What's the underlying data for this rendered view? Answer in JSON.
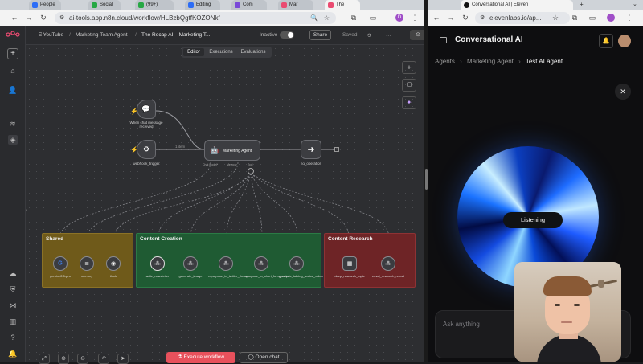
{
  "left_browser": {
    "tabs": [
      {
        "label": "People",
        "color": "#2d6df6"
      },
      {
        "label": "Social",
        "color": "#27a844"
      },
      {
        "label": "(99+)",
        "color": "#27a844"
      },
      {
        "label": "Editing",
        "color": "#2d6df6"
      },
      {
        "label": "Com",
        "color": "#7a4ad8"
      },
      {
        "label": "Mar",
        "color": "#ea4b71"
      },
      {
        "label": "The",
        "color": "#ea4b71"
      }
    ],
    "url": "ai-tools.app.n8n.cloud/workflow/HLBzbQgtfKOZONkf",
    "profile_initial": "D"
  },
  "n8n": {
    "breadcrumb": {
      "project": "YouTube",
      "folder": "Marketing Team Agent",
      "workflow": "The Recap AI – Marketing T..."
    },
    "status_label": "Inactive",
    "share_label": "Share",
    "saved_label": "Saved",
    "tabs": [
      "Editor",
      "Executions",
      "Evaluations"
    ],
    "nodes": {
      "chat_trigger": "When chat message received",
      "webhook_trigger": "webhook_trigger",
      "agent": "Marketing Agent",
      "no_operation": "no_operation",
      "agent_ports": [
        "Chat Model*",
        "Memory",
        "Tool"
      ],
      "edge_label": "1 item"
    },
    "groups": {
      "shared": {
        "title": "Shared",
        "color": "#6f5a1a",
        "items": [
          "gemini-2.5-pro",
          "memory",
          "think"
        ]
      },
      "content_creation": {
        "title": "Content Creation",
        "color": "#1f5b33",
        "items": [
          "write_newsletter",
          "generate_image",
          "repurpose_to_twitter_thread",
          "repurpose_to_short_form_script",
          "generate_talking_avatar_video"
        ]
      },
      "content_research": {
        "title": "Content Research",
        "color": "#6e2426",
        "items": [
          "deep_research_topic",
          "email_research_report"
        ]
      }
    },
    "execute_label": "Execute workflow",
    "open_chat_label": "Open chat"
  },
  "right_browser": {
    "tab_title": "Conversational AI | Eleven",
    "url": "elevenlabs.io/ap..."
  },
  "elevenlabs": {
    "title": "Conversational AI",
    "breadcrumb": [
      "Agents",
      "Marketing Agent",
      "Test AI agent"
    ],
    "status": "Listening",
    "input_placeholder": "Ask anything"
  }
}
